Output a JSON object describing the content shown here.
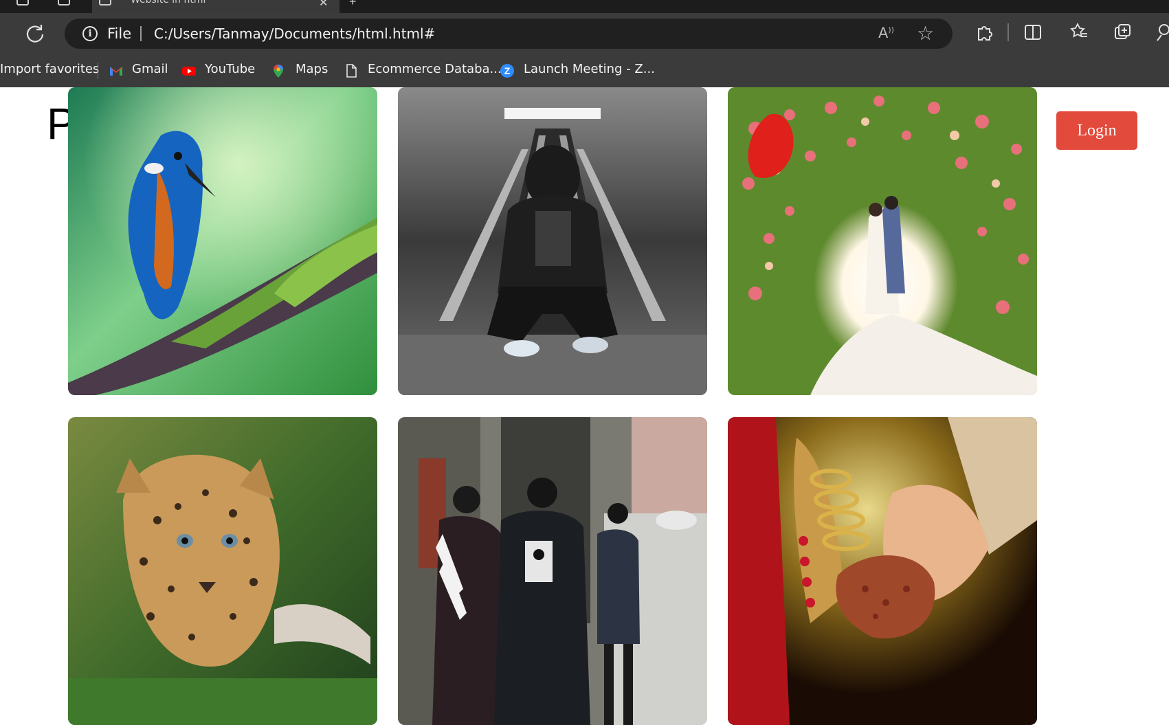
{
  "browser": {
    "tab": {
      "title": "Website in html",
      "close_label": "✕",
      "new_tab_label": "+"
    },
    "address": {
      "scheme_label": "File",
      "url": "C:/Users/Tanmay/Documents/html.html#"
    },
    "icons": {
      "reload": "reload-icon",
      "info": "info-icon",
      "read_aloud": "read-aloud-icon",
      "favorite": "star-icon",
      "extensions": "puzzle-icon",
      "split_screen": "split-screen-icon",
      "favorites": "favorites-icon",
      "collections": "collections-icon",
      "profile": "profile-icon"
    },
    "bookmarks": [
      {
        "label": "Import favorites",
        "icon": "none"
      },
      {
        "label": "Gmail",
        "icon": "gmail-icon"
      },
      {
        "label": "YouTube",
        "icon": "youtube-icon"
      },
      {
        "label": "Maps",
        "icon": "maps-icon"
      },
      {
        "label": "Ecommerce Databa...",
        "icon": "document-icon"
      },
      {
        "label": "Launch Meeting - Z...",
        "icon": "zoom-icon"
      }
    ]
  },
  "page": {
    "heading_visible": "P",
    "login_label": "Login",
    "accent_color": "#e24a3c",
    "gallery": [
      {
        "subject": "kingfisher-bird"
      },
      {
        "subject": "man-crouching-by-escalator"
      },
      {
        "subject": "couple-in-flower-arch"
      },
      {
        "subject": "leopard-cub"
      },
      {
        "subject": "people-walking-street"
      },
      {
        "subject": "bride-groom-hands-henna"
      }
    ]
  }
}
